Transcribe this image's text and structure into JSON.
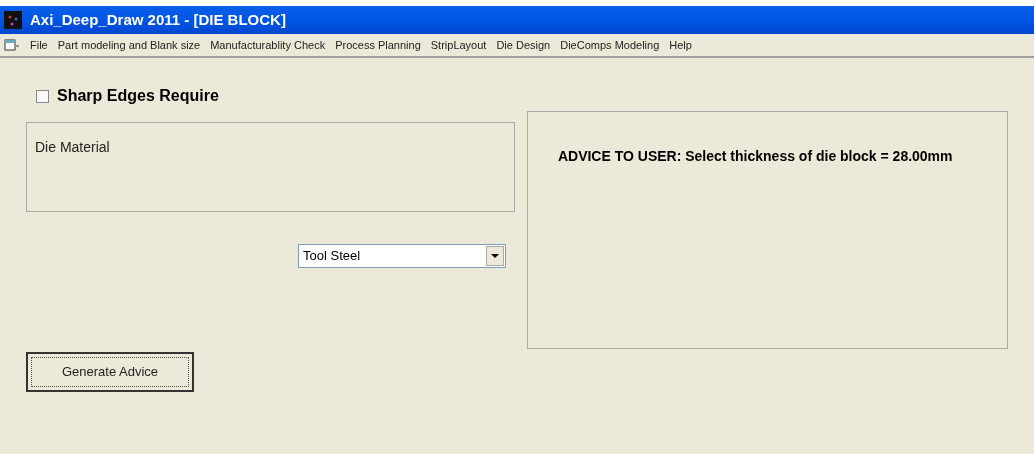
{
  "window": {
    "title": "Axi_Deep_Draw 2011 - [DIE BLOCK]"
  },
  "menu": [
    "File",
    "Part modeling and Blank size",
    "Manufacturablity Check",
    "Process Planning",
    "StripLayout",
    "Die Design",
    "DieComps Modeling",
    "Help"
  ],
  "sharp_edges": {
    "label": "Sharp Edges Require",
    "checked": false
  },
  "die_material": {
    "label": "Die Material",
    "value": "Tool Steel"
  },
  "advice": "ADVICE TO USER: Select thickness of die block = 28.00mm",
  "buttons": [
    "Generate Advice"
  ]
}
